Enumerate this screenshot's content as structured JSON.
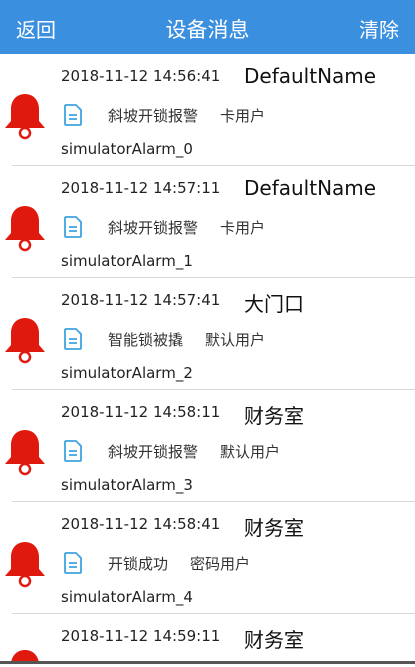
{
  "header": {
    "back": "返回",
    "title": "设备消息",
    "clear": "清除"
  },
  "items": [
    {
      "date": "2018-11-12 14:56:41",
      "name": "DefaultName",
      "message": "斜坡开锁报警",
      "user": "卡用户",
      "alarm": "simulatorAlarm_0"
    },
    {
      "date": "2018-11-12 14:57:11",
      "name": "DefaultName",
      "message": "斜坡开锁报警",
      "user": "卡用户",
      "alarm": "simulatorAlarm_1"
    },
    {
      "date": "2018-11-12 14:57:41",
      "name": "大门口",
      "message": "智能锁被撬",
      "user": "默认用户",
      "alarm": "simulatorAlarm_2"
    },
    {
      "date": "2018-11-12 14:58:11",
      "name": "财务室",
      "message": "斜坡开锁报警",
      "user": "默认用户",
      "alarm": "simulatorAlarm_3"
    },
    {
      "date": "2018-11-12 14:58:41",
      "name": "财务室",
      "message": "开锁成功",
      "user": "密码用户",
      "alarm": "simulatorAlarm_4"
    },
    {
      "date": "2018-11-12 14:59:11",
      "name": "财务室",
      "message": "",
      "user": "",
      "alarm": ""
    }
  ],
  "colors": {
    "header": "#3b8fdf",
    "bell": "#e0190f",
    "doc": "#3fa4e0"
  }
}
